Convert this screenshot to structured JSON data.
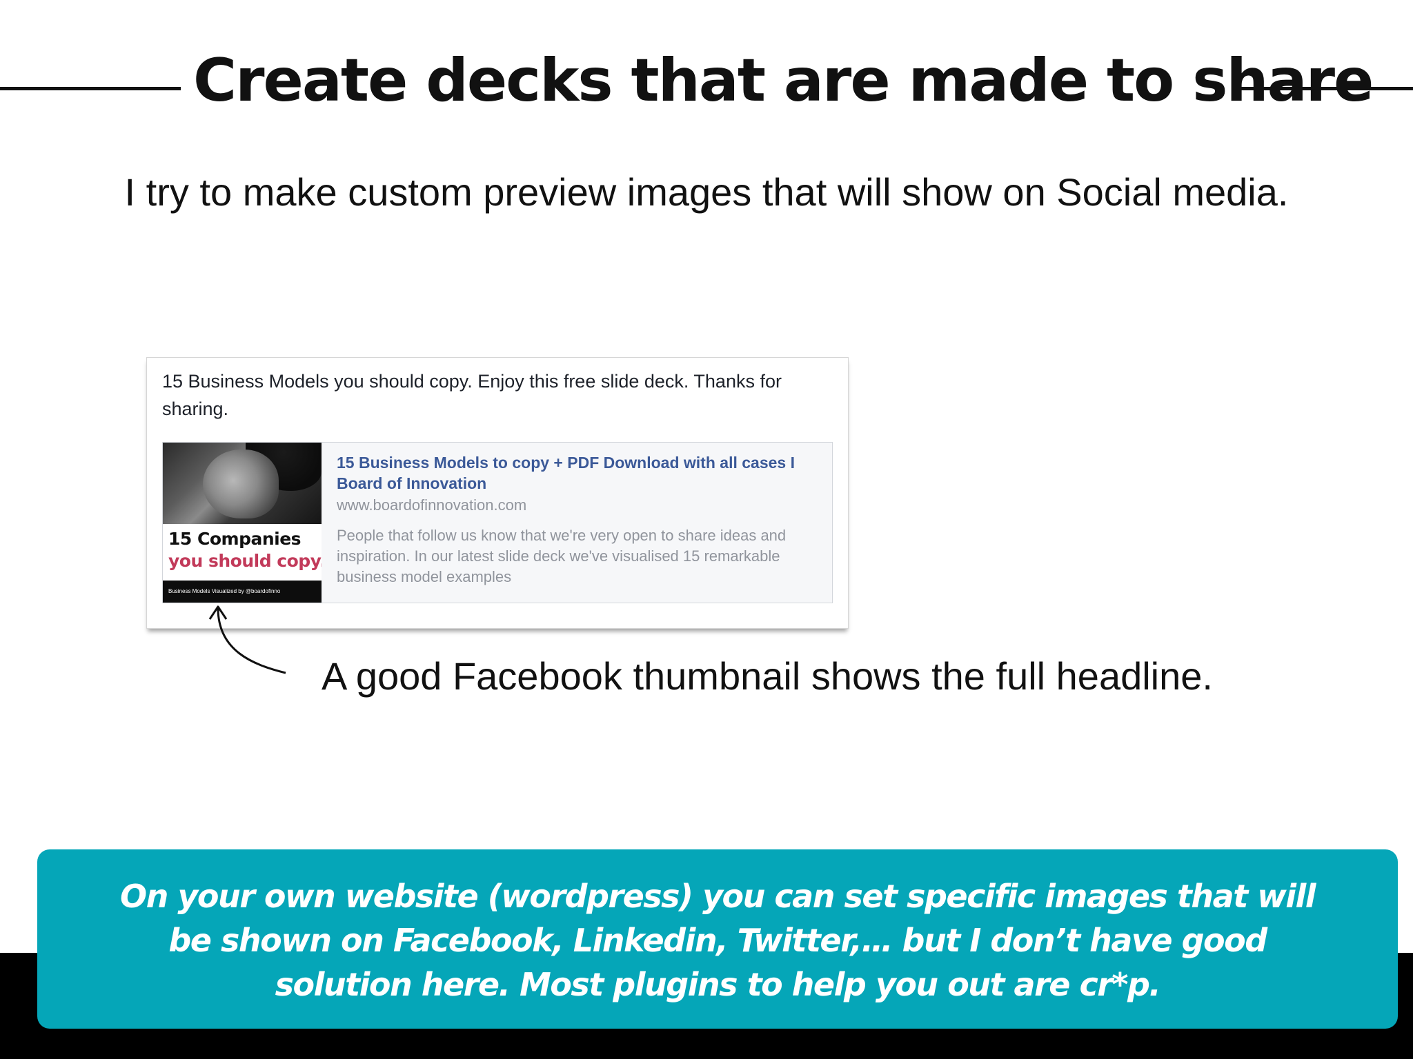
{
  "slide": {
    "title": "Create decks that are made to share",
    "subtitle": "I try to make custom preview images that will show on Social media.",
    "caption": "A good Facebook thumbnail shows the full headline.",
    "callout": "On your own website (wordpress) you can set specific images that will be shown on Facebook, Linkedin, Twitter,… but I don’t have good solution here. Most plugins to help you out are cr*p."
  },
  "facebook_post": {
    "text": "15 Business Models you should copy. Enjoy this free slide deck. Thanks for sharing.",
    "thumbnail": {
      "line1": "15 Companies",
      "line2": "you should copy.",
      "footer": "Business Models Visualized by @boardofinno"
    },
    "link": {
      "title": "15 Business Models to copy + PDF Download with all cases I Board of Innovation",
      "domain": "www.boardofinnovation.com",
      "description": "People that follow us know that we're very open to share ideas and inspiration. In our latest slide deck we've visualised 15 remarkable business model examples"
    }
  },
  "colors": {
    "callout_background": "#05a6b8",
    "link_title": "#3b5998",
    "thumbnail_accent": "#c23a5a"
  }
}
